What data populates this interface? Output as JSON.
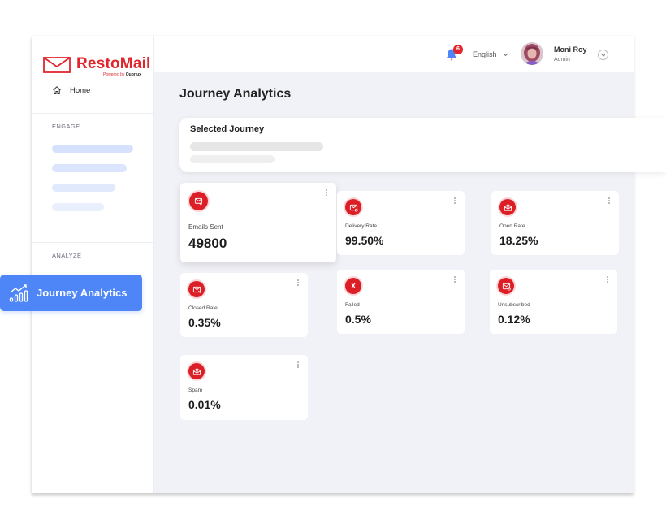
{
  "brand": {
    "name": "RestoMail",
    "powered_by_prefix": "Powered by",
    "powered_by_name": "Qubrlux",
    "color": "#e0262d"
  },
  "sidebar": {
    "home_label": "Home",
    "sections": [
      {
        "label": "ENGAGE",
        "items_loading": 4
      },
      {
        "label": "ANALYZE"
      }
    ],
    "active_item": {
      "label": "Journey Analytics",
      "icon": "bar-chart-trend-icon",
      "color": "#4f86f7"
    }
  },
  "topbar": {
    "notifications": {
      "icon": "bell-icon",
      "count": "6"
    },
    "language": "English",
    "user": {
      "name": "Moni Roy",
      "role": "Admin"
    }
  },
  "main": {
    "title": "Journey Analytics",
    "selected_journey": {
      "label": "Selected Journey"
    },
    "metrics": [
      {
        "label": "Emails Sent",
        "value": "49800",
        "icon": "mail-send-icon"
      },
      {
        "label": "Delivery Rate",
        "value": "99.50%",
        "icon": "mail-delivered-icon"
      },
      {
        "label": "Open Rate",
        "value": "18.25%",
        "icon": "mail-open-icon"
      },
      {
        "label": "Closed Rate",
        "value": "0.35%",
        "icon": "mail-closed-icon"
      },
      {
        "label": "Failed",
        "value": "0.5%",
        "icon": "x-icon"
      },
      {
        "label": "Unsubscribed",
        "value": "0.12%",
        "icon": "mail-unsubscribe-icon"
      },
      {
        "label": "Spam",
        "value": "0.01%",
        "icon": "mail-spam-icon"
      }
    ]
  }
}
